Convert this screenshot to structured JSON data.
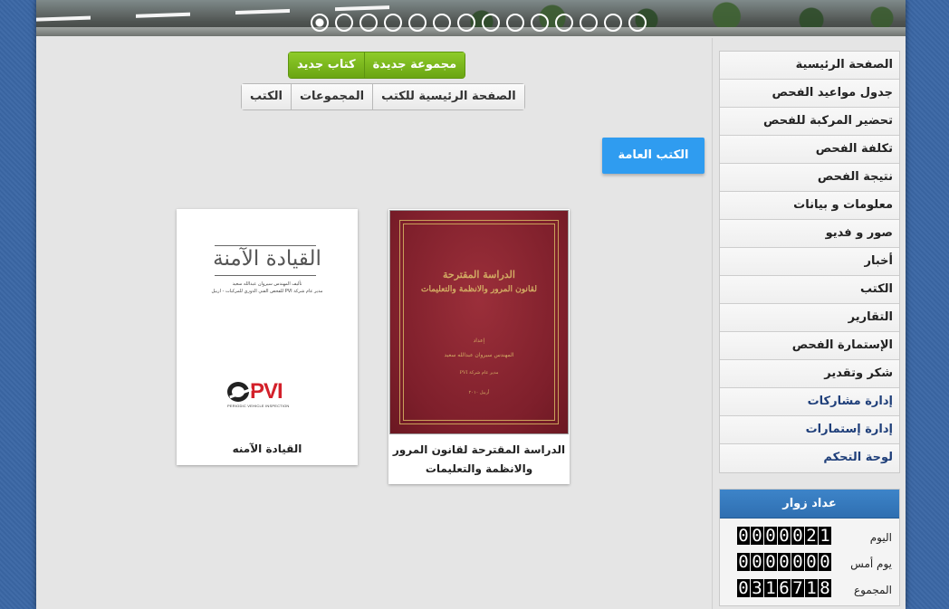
{
  "banner": {
    "slide_count": 14,
    "active_index": 0
  },
  "toolbar": {
    "new_group": "مجموعة جديدة",
    "new_book": "كتاب جديد",
    "books_home": "الصفحة الرئيسية للكتب",
    "groups": "المجموعات",
    "books": "الكتب"
  },
  "public_books_label": "الكتب العامة",
  "books": [
    {
      "title": "الدراسة المقترحة لقانون المرور والانظمة والتعليمات",
      "cover": {
        "title_line1": "الدراسة المقترحة",
        "title_line2": "لقانون المرور والانظمة والتعليمات",
        "line3": "إعداد",
        "line4": "المهندس سيروان عبدالله سعيد",
        "line5": "مدير عام شركة PVI",
        "line6": "أربيل ٢٠١٠"
      }
    },
    {
      "title": "القيادة الآمنه",
      "cover": {
        "title": "القيادة الآمنة",
        "line1": "تأليف المهندس سيروان عبدالله سعيد",
        "line2": "مدير عام شركة PVI للفحص الفني الدوري للمركبات - اربيل",
        "logo_text": "PVI",
        "logo_sub": "PERIODIC VEHICLE INSPECTION"
      }
    }
  ],
  "sidebar": {
    "items": [
      {
        "label": "الصفحة الرئيسية"
      },
      {
        "label": "جدول مواعيد الفحص"
      },
      {
        "label": "تحضير المركبة للفحص"
      },
      {
        "label": "تكلفة الفحص"
      },
      {
        "label": "نتيجة الفحص"
      },
      {
        "label": "معلومات و بيانات"
      },
      {
        "label": "صور و فديو"
      },
      {
        "label": "أخبار"
      },
      {
        "label": "الكتب"
      },
      {
        "label": "التقارير"
      },
      {
        "label": "الإستمارة الفحص"
      },
      {
        "label": "شكر وتقدير"
      },
      {
        "label": "إدارة مشاركات"
      },
      {
        "label": "إدارة إستمارات"
      },
      {
        "label": "لوحة التحكم"
      }
    ]
  },
  "visitor_counter": {
    "title": "عداد زوار",
    "rows": [
      {
        "label": "اليوم",
        "value": "0000021"
      },
      {
        "label": "يوم أمس",
        "value": "0000000"
      },
      {
        "label": "المجموع",
        "value": "0316718"
      }
    ]
  },
  "colors": {
    "accent_blue": "#2f9cf0",
    "accent_green": "#7bb81c",
    "counter_header": "#3579bd",
    "background": "#3b67a5"
  }
}
